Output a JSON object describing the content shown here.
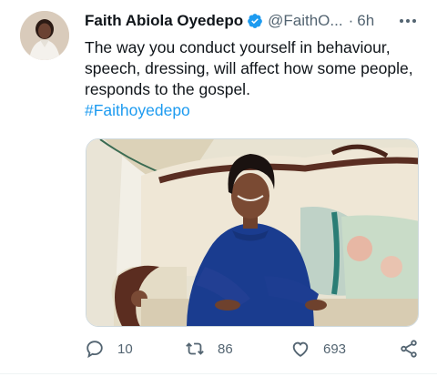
{
  "tweet": {
    "author_name": "Faith Abiola Oyedepo",
    "handle": "@FaithO...",
    "separator": "·",
    "time": "6h",
    "text": "The way you conduct yourself in behaviour, speech, dressing, will affect how some people, responds to the gospel.",
    "hashtag": "#Faithoyedepo",
    "verified": true
  },
  "actions": {
    "reply_count": "10",
    "retweet_count": "86",
    "like_count": "693"
  },
  "icons": [
    "avatar",
    "verified-badge-icon",
    "more-options-icon",
    "reply-icon",
    "retweet-icon",
    "like-icon",
    "share-icon"
  ],
  "colors": {
    "text": "#0f1419",
    "secondary": "#536471",
    "link": "#1d9bf0",
    "verified": "#1d9bf0"
  }
}
